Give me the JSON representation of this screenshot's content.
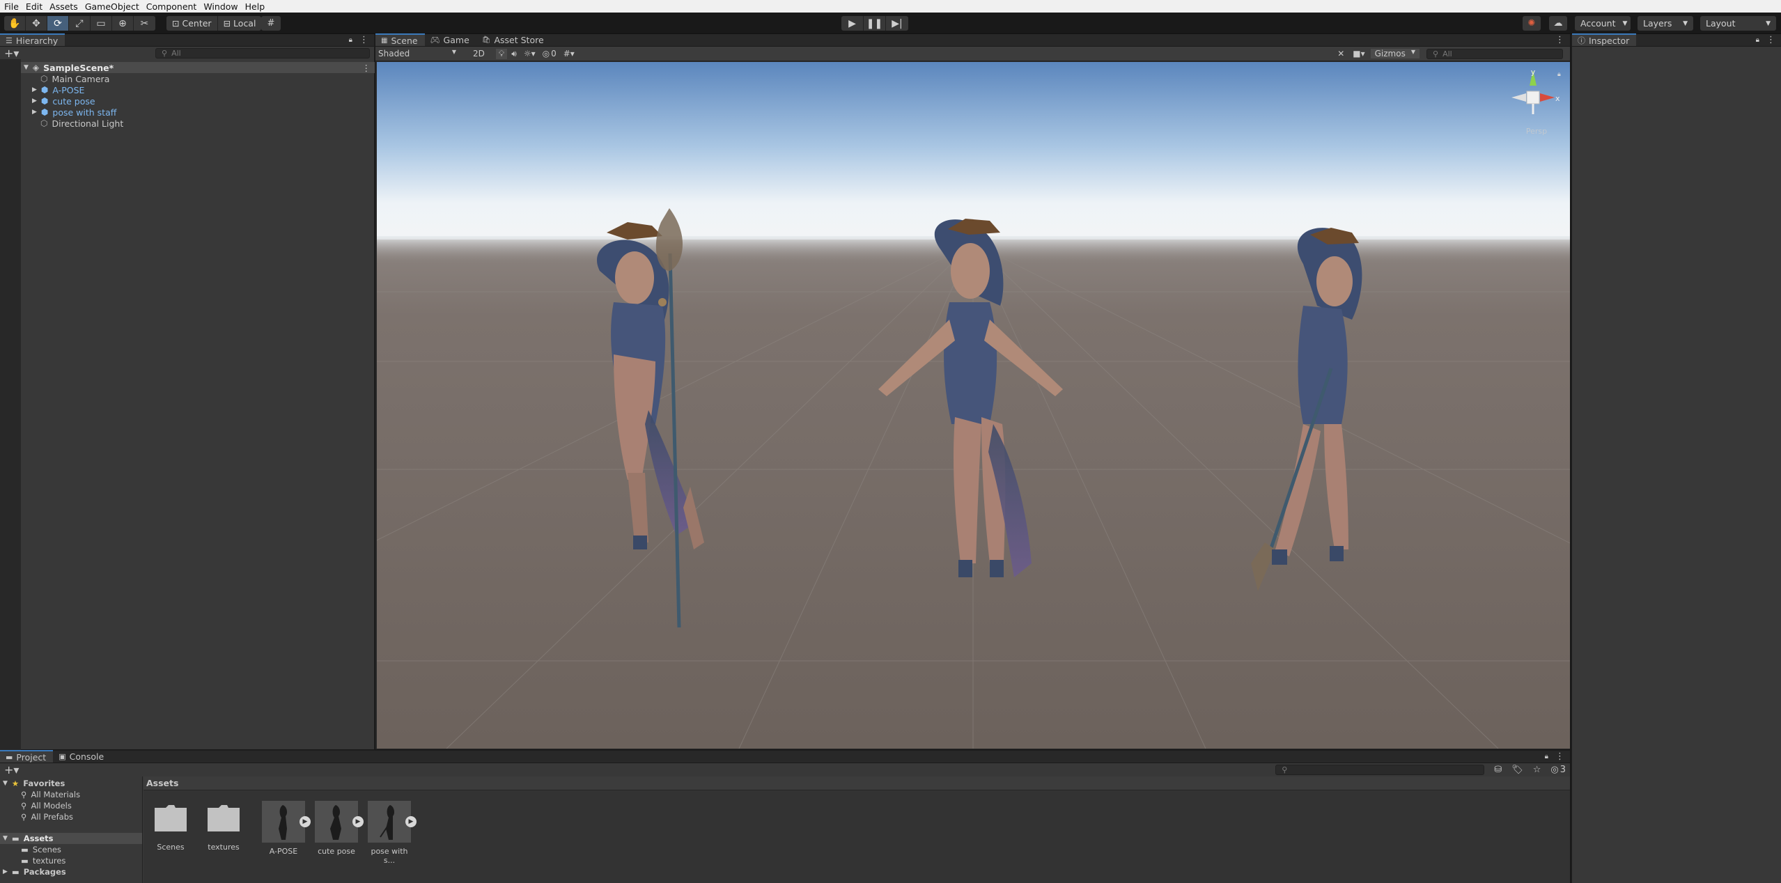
{
  "menu": [
    "File",
    "Edit",
    "Assets",
    "GameObject",
    "Component",
    "Window",
    "Help"
  ],
  "toolbar": {
    "tools": [
      "hand",
      "move",
      "rotate",
      "scale",
      "rect",
      "transform",
      "custom"
    ],
    "active_tool": 2,
    "pivot_label": "Center",
    "space_label": "Local",
    "account_label": "Account",
    "layers_label": "Layers",
    "layout_label": "Layout"
  },
  "hierarchy": {
    "title": "Hierarchy",
    "search_placeholder": "All",
    "scene_name": "SampleScene*",
    "items": [
      {
        "label": "Main Camera",
        "prefab": false,
        "expandable": false
      },
      {
        "label": "A-POSE",
        "prefab": true,
        "expandable": true
      },
      {
        "label": "cute pose",
        "prefab": true,
        "expandable": true
      },
      {
        "label": "pose with staff",
        "prefab": true,
        "expandable": true
      },
      {
        "label": "Directional Light",
        "prefab": false,
        "expandable": false
      }
    ]
  },
  "scene_view": {
    "tabs": [
      "Scene",
      "Game",
      "Asset Store"
    ],
    "active_tab": 0,
    "shading": "Shaded",
    "mode_2d": "2D",
    "hidden_count": "0",
    "gizmos_label": "Gizmos",
    "search_placeholder": "All",
    "gizmo_label": "Persp"
  },
  "inspector": {
    "title": "Inspector"
  },
  "bottom": {
    "tabs": [
      "Project",
      "Console"
    ],
    "active_tab": 0,
    "badge_count": "3",
    "favorites_title": "Favorites",
    "favorites": [
      "All Materials",
      "All Models",
      "All Prefabs"
    ],
    "assets_title": "Assets",
    "asset_folders": [
      "Scenes",
      "textures"
    ],
    "packages_title": "Packages",
    "breadcrumb": "Assets",
    "assets": [
      {
        "label": "Scenes",
        "kind": "folder"
      },
      {
        "label": "textures",
        "kind": "folder"
      },
      {
        "label": "A-POSE",
        "kind": "model"
      },
      {
        "label": "cute pose",
        "kind": "model"
      },
      {
        "label": "pose with s...",
        "kind": "model"
      }
    ]
  }
}
